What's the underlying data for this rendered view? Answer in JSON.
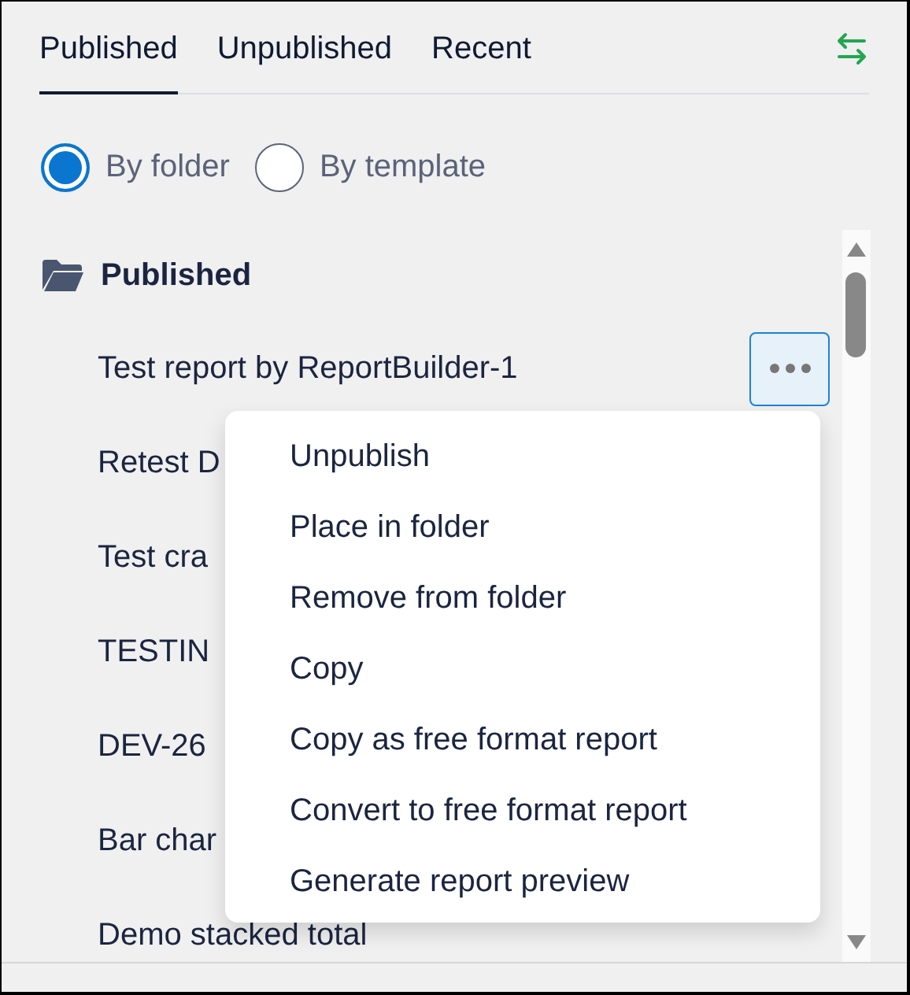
{
  "tabs": [
    {
      "label": "Published",
      "selected": true
    },
    {
      "label": "Unpublished",
      "selected": false
    },
    {
      "label": "Recent",
      "selected": false
    }
  ],
  "view_options": [
    {
      "label": "By folder",
      "selected": true
    },
    {
      "label": "By template",
      "selected": false
    }
  ],
  "folder": {
    "name": "Published"
  },
  "reports": [
    {
      "name": "Test report by ReportBuilder-1",
      "menu_open": true
    },
    {
      "name": "Retest D",
      "menu_open": false
    },
    {
      "name": "Test cra",
      "menu_open": false
    },
    {
      "name": "TESTIN",
      "menu_open": false
    },
    {
      "name": "DEV-26",
      "menu_open": false
    },
    {
      "name": "Bar char",
      "menu_open": false
    },
    {
      "name": "Demo stacked total",
      "menu_open": false
    }
  ],
  "context_menu": [
    "Unpublish",
    "Place in folder",
    "Remove from folder",
    "Copy",
    "Copy as free format report",
    "Convert to free format report",
    "Generate report preview"
  ]
}
